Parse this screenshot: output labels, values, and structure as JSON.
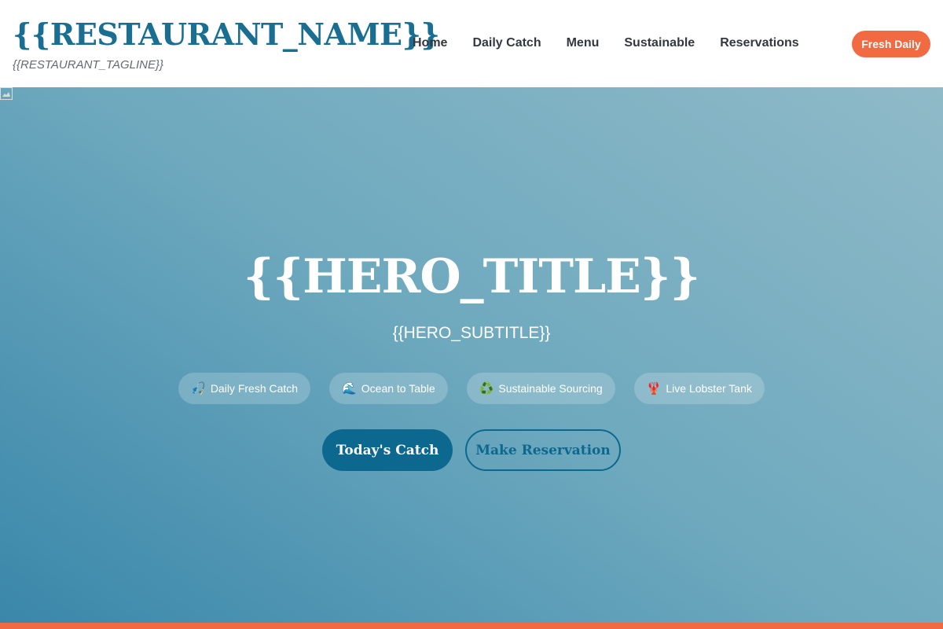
{
  "header": {
    "restaurant_name": "{{RESTAURANT_NAME}}",
    "tagline": "{{RESTAURANT_TAGLINE}}",
    "nav": [
      {
        "label": "Home"
      },
      {
        "label": "Daily Catch"
      },
      {
        "label": "Menu"
      },
      {
        "label": "Sustainable"
      },
      {
        "label": "Reservations"
      }
    ],
    "badge_label": "Fresh Daily"
  },
  "hero": {
    "title": "{{HERO_TITLE}}",
    "subtitle": "{{HERO_SUBTITLE}}",
    "features": [
      {
        "icon": "🎣",
        "icon_name": "fishing-icon",
        "label": "Daily Fresh Catch"
      },
      {
        "icon": "🌊",
        "icon_name": "wave-icon",
        "label": "Ocean to Table"
      },
      {
        "icon": "♻️",
        "icon_name": "recycle-icon",
        "label": "Sustainable Sourcing"
      },
      {
        "icon": "🦞",
        "icon_name": "lobster-icon",
        "label": "Live Lobster Tank"
      }
    ],
    "primary_cta": "Today's Catch",
    "secondary_cta": "Make Reservation"
  },
  "colors": {
    "brand_blue": "#1a6e92",
    "accent_orange": "#f26a42",
    "button_blue": "#0d6890"
  }
}
